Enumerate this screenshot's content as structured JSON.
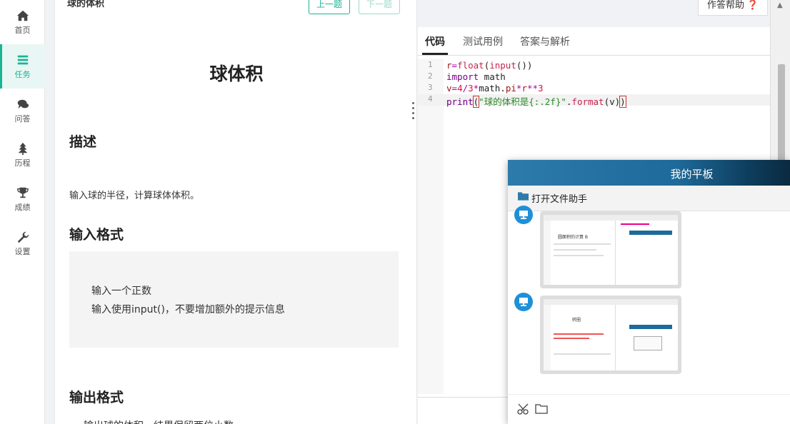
{
  "sidebar": {
    "items": [
      {
        "label": "首页",
        "icon": "home-icon",
        "active": false
      },
      {
        "label": "任务",
        "icon": "tasks-icon",
        "active": true
      },
      {
        "label": "问答",
        "icon": "chat-icon",
        "active": false
      },
      {
        "label": "历程",
        "icon": "tree-icon",
        "active": false
      },
      {
        "label": "成绩",
        "icon": "trophy-icon",
        "active": false
      },
      {
        "label": "设置",
        "icon": "wrench-icon",
        "active": false
      }
    ]
  },
  "problem": {
    "header_title": "球的体积",
    "prev_label": "上一题",
    "next_label": "下一题",
    "title": "球体积",
    "desc_heading": "描述",
    "desc_text": "输入球的半径，计算球体体积。",
    "input_heading": "输入格式",
    "input_lines": [
      "输入一个正数",
      "输入使用input()，不要增加额外的提示信息"
    ],
    "output_heading": "输出格式",
    "output_text": "输出球的体积，结果保留两位小数"
  },
  "editor": {
    "help_label": "作答帮助",
    "tabs": [
      "代码",
      "测试用例",
      "答案与解析"
    ],
    "active_tab": 0,
    "lines": [
      {
        "num": "1",
        "code": "r=float(input())"
      },
      {
        "num": "2",
        "code": "import math"
      },
      {
        "num": "3",
        "code": "v=4/3*math.pi*r**3"
      },
      {
        "num": "4",
        "code": "print(\"球的体积是{:.2f}\".format(v))"
      }
    ],
    "current_line": 4
  },
  "tablet": {
    "title": "我的平板",
    "file_helper_label": "打开文件助手",
    "thumbs": [
      {
        "title": "圆面积的计算 B"
      },
      {
        "title": "转圈"
      }
    ]
  },
  "colors": {
    "accent": "#1ab394",
    "tablet_head": "#1e6a9a"
  }
}
